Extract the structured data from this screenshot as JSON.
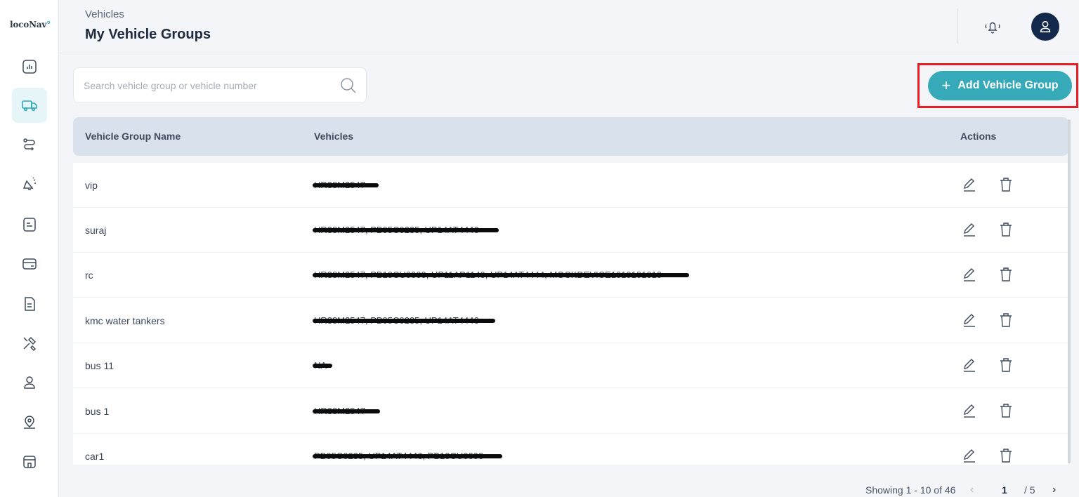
{
  "app": {
    "logo_text": "locoNav",
    "brand_color": "#36aab8"
  },
  "sidebar": {
    "items": [
      {
        "icon": "dashboard-icon"
      },
      {
        "icon": "truck-icon",
        "active": true
      },
      {
        "icon": "route-icon"
      },
      {
        "icon": "alert-icon"
      },
      {
        "icon": "reports-icon"
      },
      {
        "icon": "card-icon"
      },
      {
        "icon": "document-icon"
      },
      {
        "icon": "tools-icon"
      },
      {
        "icon": "user-icon"
      },
      {
        "icon": "location-icon"
      },
      {
        "icon": "store-icon"
      }
    ]
  },
  "header": {
    "breadcrumb": "Vehicles",
    "title": "My Vehicle Groups"
  },
  "search": {
    "placeholder": "Search vehicle group or vehicle number",
    "value": ""
  },
  "actions": {
    "add_label": "Add Vehicle Group"
  },
  "table": {
    "columns": {
      "name": "Vehicle Group Name",
      "vehicles": "Vehicles",
      "actions": "Actions"
    },
    "rows": [
      {
        "name": "vip",
        "vehicles": "HR38M2547"
      },
      {
        "name": "suraj",
        "vehicles": "HR38M2547, PB05C0235, UP14AT4446"
      },
      {
        "name": "rc",
        "vehicles": "HR38M2547, PB10CU0000, UP11AP1140, UP14AT4444, MOCKDEVICE1010101010"
      },
      {
        "name": "kmc water tankers",
        "vehicles": "HR38M2547, PB05C0235, UP14AT4446"
      },
      {
        "name": "bus 11",
        "vehicles": "NA"
      },
      {
        "name": "bus 1",
        "vehicles": "HR38M2547"
      },
      {
        "name": "car1",
        "vehicles": "PB05C0235, UP14AT4446, PB10CU0000"
      }
    ]
  },
  "pagination": {
    "showing": "Showing 1 - 10 of 46",
    "current": "1",
    "total": "/ 5"
  }
}
